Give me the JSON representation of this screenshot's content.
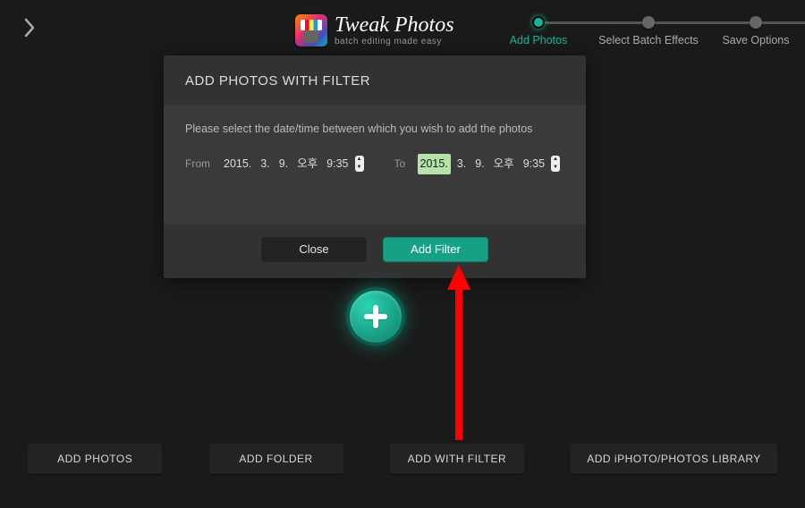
{
  "app": {
    "title": "Tweak Photos",
    "subtitle": "batch editing made easy"
  },
  "stepper": {
    "steps": [
      {
        "label": "Add Photos"
      },
      {
        "label": "Select Batch Effects"
      },
      {
        "label": "Save Options"
      }
    ]
  },
  "modal": {
    "title": "ADD PHOTOS WITH FILTER",
    "description": "Please select the date/time between which you wish to add the photos",
    "from_label": "From",
    "to_label": "To",
    "from": {
      "year": "2015.",
      "month": "3.",
      "day": "9.",
      "ampm": "오후",
      "time": "9:35"
    },
    "to": {
      "year": "2015.",
      "month": "3.",
      "day": "9.",
      "ampm": "오후",
      "time": "9:35"
    },
    "close_label": "Close",
    "add_filter_label": "Add Filter"
  },
  "bottom": {
    "add_photos": "ADD PHOTOS",
    "add_folder": "ADD FOLDER",
    "add_with_filter": "ADD WITH FILTER",
    "add_library": "ADD iPHOTO/PHOTOS LIBRARY"
  },
  "colors": {
    "accent": "#17b497",
    "annotation_red": "#ff0000"
  }
}
